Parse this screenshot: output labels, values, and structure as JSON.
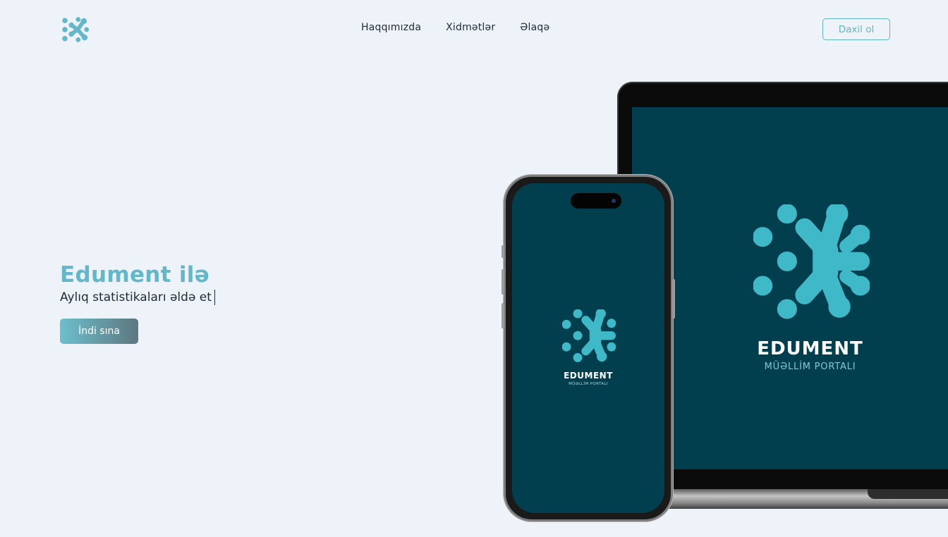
{
  "header": {
    "nav": [
      "Haqqımızda",
      "Xidmətlər",
      "Əlaqə"
    ],
    "login_label": "Daxil ol"
  },
  "hero": {
    "title": "Edument ilə",
    "subtitle": "Aylıq statistikaları əldə et",
    "cta_label": "İndi sına"
  },
  "devices": {
    "brand_name": "EDUMENT",
    "brand_tagline": "MÜƏLLİM PORTALI"
  },
  "colors": {
    "accent": "#63b7c8",
    "screen": "#013f4f",
    "logo_mark": "#3fb9c8",
    "background": "#eef3f9"
  },
  "icons": {
    "logo": "edument-molecule-logo-icon"
  }
}
